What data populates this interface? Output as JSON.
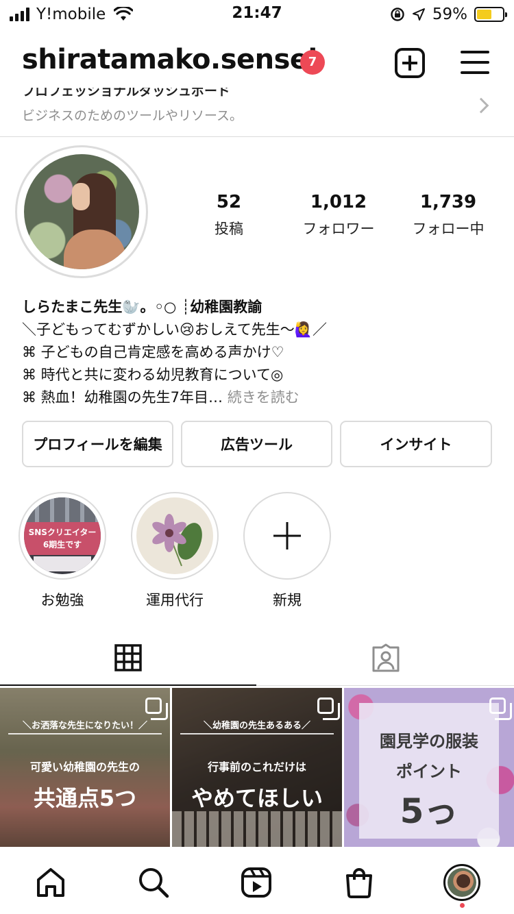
{
  "status_bar": {
    "carrier": "Y!mobile",
    "time": "21:47",
    "battery_percent": "59%",
    "battery_level": 0.59
  },
  "header": {
    "username": "shiratamako.sensei",
    "notification_count": "7"
  },
  "pro_dashboard": {
    "title": "プロフェッショナルダッシュボード",
    "subtitle": "ビジネスのためのツールやリソース。"
  },
  "stats": [
    {
      "value": "52",
      "label": "投稿"
    },
    {
      "value": "1,012",
      "label": "フォロワー"
    },
    {
      "value": "1,739",
      "label": "フォロー中"
    }
  ],
  "bio": {
    "name_line": "しらたまこ先生🦭。◦○ ┊幼稚園教諭",
    "lines": [
      "＼子どもってむずかしい😢おしえて先生〜🙋‍♀️／",
      "⌘ 子どもの自己肯定感を高める声かけ♡",
      "⌘ 時代と共に変わる幼児教育について◎",
      "⌘ 熱血！幼稚園の先生7年目…"
    ],
    "more": "続きを読む"
  },
  "buttons": {
    "edit_profile": "プロフィールを編集",
    "ad_tools": "広告ツール",
    "insights": "インサイト"
  },
  "highlights": [
    {
      "label": "お勉強",
      "cover_text_1": "SNSクリエイター",
      "cover_text_2": "6期生です"
    },
    {
      "label": "運用代行"
    },
    {
      "label": "新規"
    }
  ],
  "posts": [
    {
      "kicker": "＼お洒落な先生になりたい！／",
      "sub": "可愛い幼稚園の先生の",
      "title": "共通点5つ"
    },
    {
      "kicker": "＼幼稚園の先生あるある／",
      "sub": "行事前のこれだけは",
      "title": "やめてほしい"
    },
    {
      "title_1": "園見学の服装",
      "title_2": "ポイント",
      "title_3": "5っ"
    }
  ],
  "colors": {
    "accent_red": "#ed4956",
    "border": "#dbdbdb",
    "muted": "#8e8e8e"
  }
}
